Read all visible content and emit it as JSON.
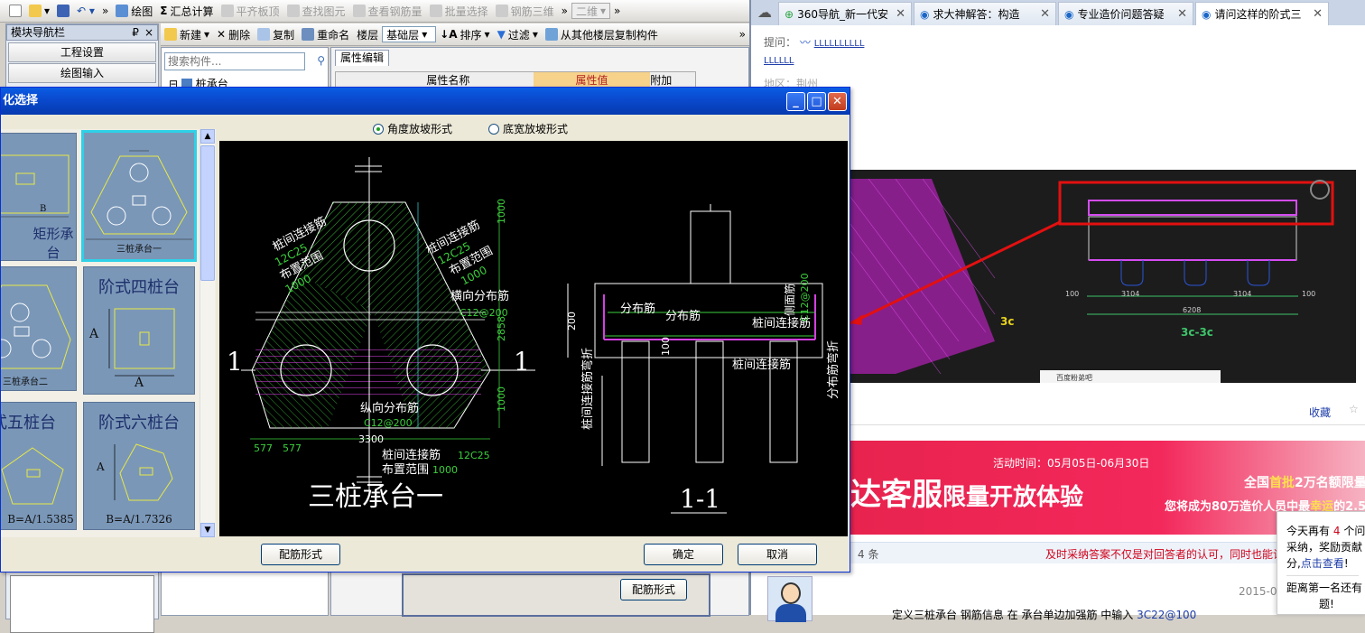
{
  "toolbar1": {
    "draw": "绘图",
    "sum": "汇总计算",
    "flat_top": "平齐板顶",
    "find_elem": "查找图元",
    "view_rebar": "查看钢筋量",
    "batch_select": "批量选择",
    "rebar_3d": "钢筋三维",
    "view_mode": "二维"
  },
  "toolbar2": {
    "new": "新建",
    "delete": "删除",
    "copy": "复制",
    "rename": "重命名",
    "floor_label": "楼层",
    "floor_value": "基础层",
    "sort": "排序",
    "filter": "过滤",
    "copy_from_floor": "从其他楼层复制构件"
  },
  "nav": {
    "title": "模块导航栏",
    "pin": "₽",
    "close": "×",
    "project_settings": "工程设置",
    "drawing_input": "绘图输入"
  },
  "search": {
    "placeholder": "搜索构件..."
  },
  "tree": {
    "item": "桩承台"
  },
  "props": {
    "tab": "属性编辑",
    "col_name": "属性名称",
    "col_value": "属性值",
    "col_extra": "附加"
  },
  "bg_button": "配筋形式",
  "browser": {
    "tabs": [
      {
        "label": "360导航_新一代安"
      },
      {
        "label": "求大神解答：构造"
      },
      {
        "label": "专业造价问题答疑"
      },
      {
        "label": "请问这样的阶式三"
      }
    ],
    "ask_label": "提问：",
    "ask_user": "LLLLLLLLLL",
    "ask_user2": "LLLLLL",
    "region": "地区：荆州",
    "collect": "收藏",
    "banner_time": "活动时间：05月05日-06月30日",
    "banner_main": "达客服",
    "banner_sub": "限量开放体验",
    "banner_r1_a": "全国",
    "banner_r1_b": "首批",
    "banner_r1_c": "2万名额限量",
    "banner_r2_a": "您将成为80万造价人员中最",
    "banner_r2_b": "幸运",
    "banner_r2_c": "的2.5",
    "count": "4 条",
    "accept_tip": "及时采纳答案不仅是对回答者的认可，同时也能让",
    "date": "2015-05",
    "answer_text": "定义三桩承台 钢筋信息 在 承台单边加强筋 中输入 ",
    "answer_rebar": "3C22@100",
    "popup_line1a": "今天再有",
    "popup_num": "4",
    "popup_line1b": "个问",
    "popup_line2": "采纳，奖励贡献",
    "popup_line3a": "分,",
    "popup_link": "点击查看",
    "popup_line3b": "!",
    "popup_line4": "距离第一名还有",
    "popup_line5": "题!",
    "shot": {
      "label1": "3c",
      "label2": "3c-3c",
      "dim1": "3104",
      "dim2": "3104",
      "dim3": "6208",
      "d100a": "100",
      "d100b": "100",
      "taskbar": "百度粉弟吧"
    }
  },
  "dialog": {
    "title": "化选择",
    "radio_angle": "角度放坡形式",
    "radio_width": "底宽放坡形式",
    "cards": [
      {
        "label": "矩形承台",
        "tag": "B"
      },
      {
        "label": "三桩承台一"
      },
      {
        "label": "三桩承台二"
      },
      {
        "label": "阶式四桩台",
        "a": "A",
        "b": "A"
      },
      {
        "label": "式五桩台",
        "formula": "B=A/1.5385"
      },
      {
        "label": "阶式六桩台",
        "a": "A",
        "formula": "B=A/1.7326"
      }
    ],
    "btn_rebar": "配筋形式",
    "btn_ok": "确定",
    "btn_cancel": "取消"
  },
  "cad": {
    "sec_mark": "1",
    "link_rebar": "桩间连接筋",
    "spec_12c25": "12C25",
    "range": "布置范围",
    "val_1000": "1000",
    "transverse": "横向分布筋",
    "c12_200": "C12@200",
    "longitudinal": "纵向分布筋",
    "dim_577": "577",
    "dim_3300": "3300",
    "dim_2858": "2858",
    "caption": "三桩承台一",
    "dist_rebar": "分布筋",
    "side_rebar": "侧面筋",
    "side_spec": "C12@200",
    "bend_left": "桩间连接筋弯折",
    "bend_right": "分布筋弯折",
    "dim_200": "200",
    "dim_100": "100",
    "section_caption": "1-1"
  }
}
